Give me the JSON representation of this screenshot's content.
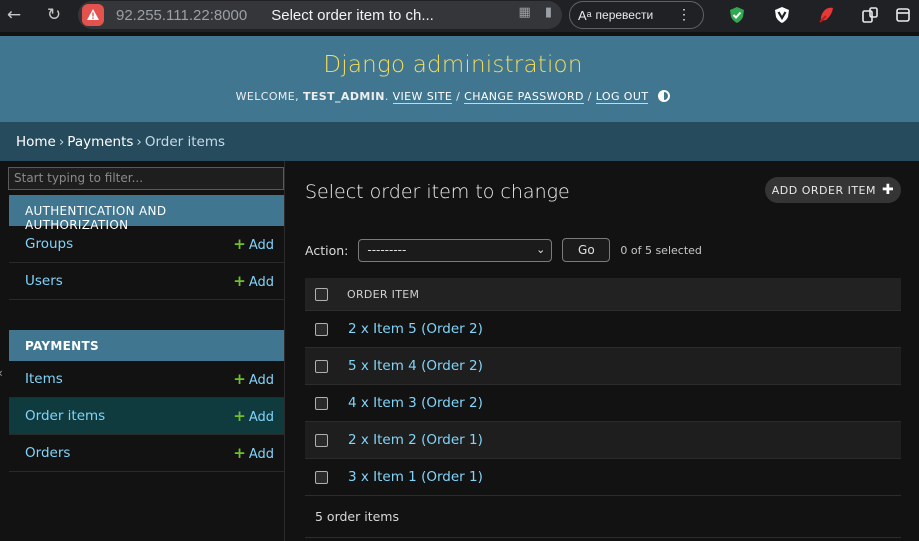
{
  "browser": {
    "url": "92.255.111.22:8000",
    "tab_title": "Select order item to ch...",
    "translate_label": "перевести"
  },
  "header": {
    "brand": "Django administration",
    "welcome": "WELCOME,",
    "username": "TEST_ADMIN",
    "view_site": "VIEW SITE",
    "change_password": "CHANGE PASSWORD",
    "log_out": "LOG OUT"
  },
  "breadcrumbs": {
    "home": "Home",
    "app": "Payments",
    "model": "Order items"
  },
  "sidebar": {
    "filter_placeholder": "Start typing to filter...",
    "modules": [
      {
        "caption": "AUTHENTICATION AND AUTHORIZATION",
        "rows": [
          {
            "name": "Groups",
            "add": "Add"
          },
          {
            "name": "Users",
            "add": "Add"
          }
        ]
      },
      {
        "caption": "PAYMENTS",
        "rows": [
          {
            "name": "Items",
            "add": "Add"
          },
          {
            "name": "Order items",
            "add": "Add"
          },
          {
            "name": "Orders",
            "add": "Add"
          }
        ]
      }
    ]
  },
  "content": {
    "title": "Select order item to change",
    "add_button": "ADD ORDER ITEM",
    "action_label": "Action:",
    "action_value": "---------",
    "go_label": "Go",
    "selected_counter": "0 of 5 selected",
    "column_header": "ORDER ITEM",
    "rows": [
      "2 x Item 5 (Order 2)",
      "5 x Item 4 (Order 2)",
      "4 x Item 3 (Order 2)",
      "2 x Item 2 (Order 1)",
      "3 x Item 1 (Order 1)"
    ],
    "paginator": "5 order items"
  },
  "colors": {
    "header_bg": "#417690",
    "brand": "#f5dd5d",
    "breadcrumbs_bg": "#264b5d",
    "link": "#81d4fa",
    "add_plus": "#70bf2b"
  }
}
